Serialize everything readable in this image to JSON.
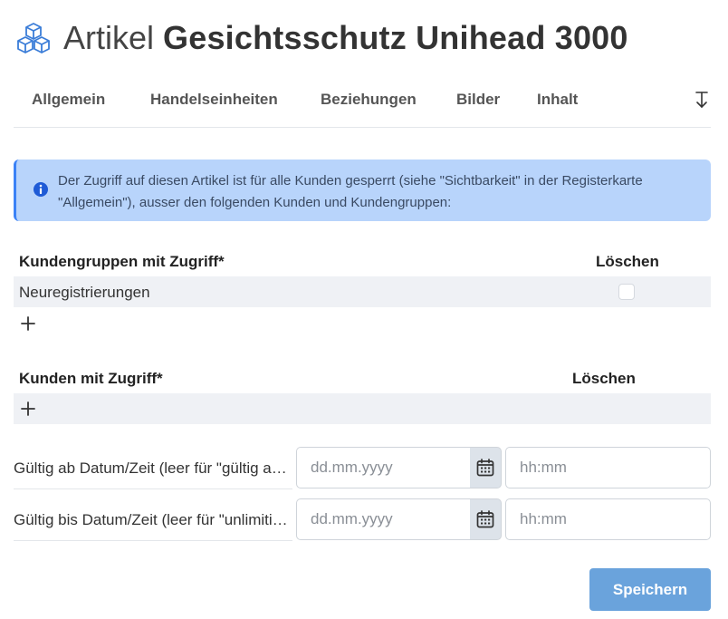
{
  "header": {
    "icon": "cubes-icon",
    "prefix": "Artikel",
    "title": "Gesichtsschutz Unihead 3000"
  },
  "tabs": [
    {
      "label": "Allgemein"
    },
    {
      "label": "Handelseinheiten"
    },
    {
      "label": "Beziehungen"
    },
    {
      "label": "Bilder"
    },
    {
      "label": "Inhalt"
    }
  ],
  "tab_scroll_icon": "arrow-down-to-line-icon",
  "alert": {
    "icon": "info-circle-icon",
    "text": "Der Zugriff auf diesen Artikel ist für alle Kunden gesperrt (siehe \"Sichtbarkeit\" in der Registerkarte \"Allgemein\"), ausser den folgenden Kunden und Kundengruppen:"
  },
  "customer_groups": {
    "header": "Kundengruppen mit Zugriff*",
    "delete_header": "Löschen",
    "rows": [
      {
        "name": "Neuregistrierungen",
        "delete_checked": false
      }
    ],
    "add_icon": "plus-icon"
  },
  "customers": {
    "header": "Kunden mit Zugriff*",
    "delete_header": "Löschen",
    "rows": [],
    "add_icon": "plus-icon"
  },
  "valid_from": {
    "label": "Gültig ab Datum/Zeit (leer für \"gültig ab sofort\")",
    "date_value": "",
    "date_placeholder": "dd.mm.yyyy",
    "time_value": "",
    "time_placeholder": "hh:mm",
    "calendar_icon": "calendar-icon"
  },
  "valid_until": {
    "label": "Gültig bis Datum/Zeit (leer für \"unlimitiert gültig\")",
    "date_value": "",
    "date_placeholder": "dd.mm.yyyy",
    "time_value": "",
    "time_placeholder": "hh:mm",
    "calendar_icon": "calendar-icon"
  },
  "save_button": "Speichern",
  "colors": {
    "alert_bg": "#b8d4fb",
    "alert_border": "#3b82f6",
    "row_bg": "#eff1f5",
    "save_bg": "#6aa3dc",
    "icon_blue": "#3b7dd8"
  }
}
